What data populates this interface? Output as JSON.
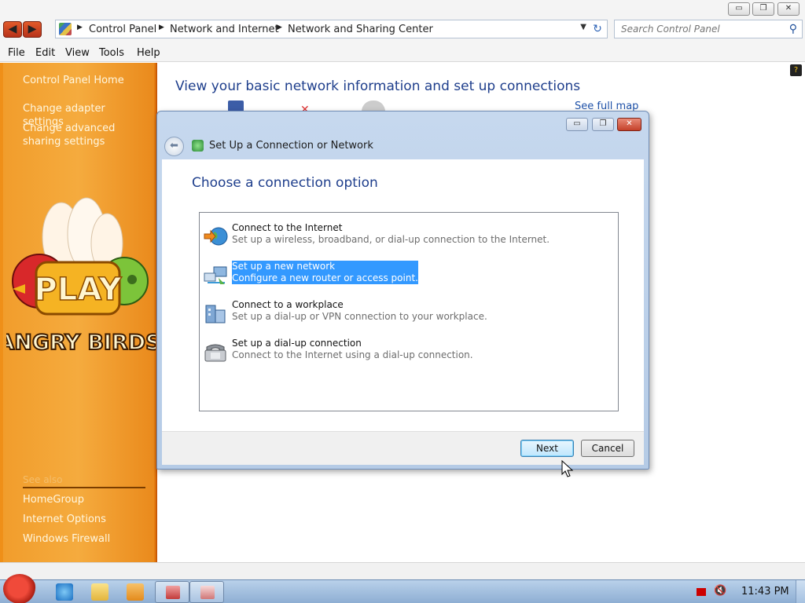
{
  "window": {
    "minimize_glyph": "▭",
    "maximize_glyph": "❐",
    "close_glyph": "✕"
  },
  "navigation": {
    "back_glyph": "◀",
    "forward_glyph": "▶",
    "breadcrumb": [
      "Control Panel",
      "Network and Internet",
      "Network and Sharing Center"
    ],
    "refresh_glyph": "↻",
    "dropdown_glyph": "▼"
  },
  "search": {
    "placeholder": "Search Control Panel",
    "icon": "search-icon"
  },
  "menu": [
    "File",
    "Edit",
    "View",
    "Tools",
    "Help"
  ],
  "left_pane": {
    "links": [
      "Control Panel Home",
      "Change adapter settings",
      "Change advanced sharing settings"
    ],
    "see_also_heading": "See also",
    "see_also_links": [
      "HomeGroup",
      "Internet Options",
      "Windows Firewall"
    ],
    "art": {
      "logo_text": "ANGRY BIRDS",
      "play_text": "PLAY"
    }
  },
  "main": {
    "title": "View your basic network information and set up connections",
    "see_full_map": "See full map"
  },
  "dialog": {
    "title": "Set Up a Connection or Network",
    "heading": "Choose a connection option",
    "options": [
      {
        "title": "Connect to the Internet",
        "description": "Set up a wireless, broadband, or dial-up connection to the Internet.",
        "icon": "globe-icon",
        "selected": false
      },
      {
        "title": "Set up a new network",
        "description": "Configure a new router or access point.",
        "icon": "network-setup-icon",
        "selected": true
      },
      {
        "title": "Connect to a workplace",
        "description": "Set up a dial-up or VPN connection to your workplace.",
        "icon": "workplace-icon",
        "selected": false
      },
      {
        "title": "Set up a dial-up connection",
        "description": "Connect to the Internet using a dial-up connection.",
        "icon": "phone-icon",
        "selected": false
      }
    ],
    "next_label": "Next",
    "cancel_label": "Cancel"
  },
  "taskbar": {
    "clock": "11:43 PM"
  },
  "colors": {
    "accent_orange": "#f19d2c",
    "link_blue": "#1e3e8c",
    "selection_blue": "#3399ff"
  }
}
